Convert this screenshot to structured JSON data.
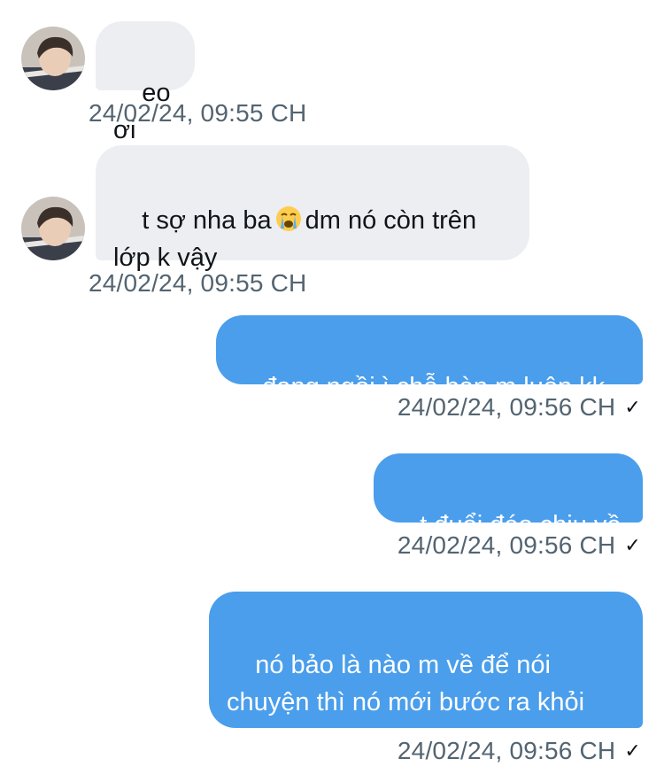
{
  "messages": [
    {
      "direction": "incoming",
      "text": "eo ơi",
      "timestamp": "24/02/24, 09:55 CH"
    },
    {
      "direction": "incoming",
      "text_before_emoji": "t sợ nha ba",
      "emoji": "loudly-crying-face",
      "text_after_emoji": "dm nó còn trên lớp k vậy",
      "timestamp": "24/02/24, 09:55 CH"
    },
    {
      "direction": "outgoing",
      "text": "đang ngồi ì chỗ bàn m luôn kk",
      "timestamp": "24/02/24, 09:56 CH",
      "status": "✓"
    },
    {
      "direction": "outgoing",
      "text": "t đuổi đéo chịu về",
      "timestamp": "24/02/24, 09:56 CH",
      "status": "✓"
    },
    {
      "direction": "outgoing",
      "text": "nó bảo là nào m về để nói chuyện thì nó mới bước ra khỏi lớp",
      "timestamp": "24/02/24, 09:56 CH",
      "status": "✓"
    }
  ],
  "colors": {
    "incoming_bubble": "#eceef1",
    "outgoing_bubble": "#4a9eeb",
    "timestamp": "#536471",
    "text_dark": "#0f1419"
  }
}
